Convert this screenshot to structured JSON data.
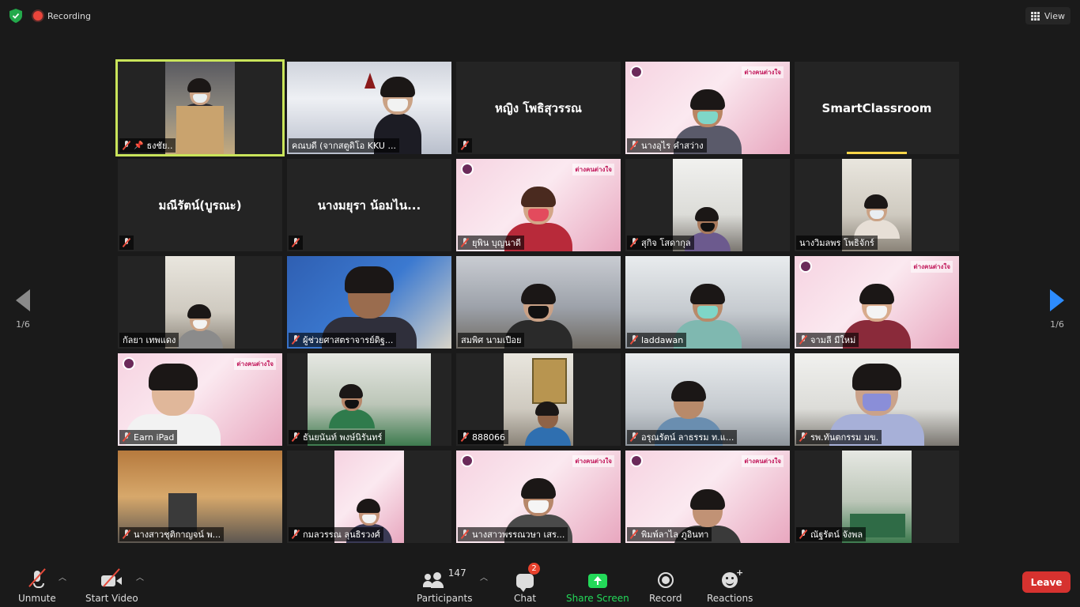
{
  "topbar": {
    "recording_label": "Recording",
    "view_label": "View"
  },
  "nav": {
    "prev_page": "1/6",
    "next_page": "1/6"
  },
  "participants": [
    {
      "name": "ธงชัย..",
      "type": "video",
      "active": true,
      "pinned": true
    },
    {
      "name": "คณบดี (จากสตูดิโอ KKU ...",
      "type": "video"
    },
    {
      "name": "หญิง โพธิสุวรรณ",
      "type": "name_only"
    },
    {
      "name": "นางอุไร คำสว่าง",
      "type": "video"
    },
    {
      "name": "SmartClassroom",
      "type": "name_only",
      "speaking": true
    },
    {
      "name": "มณีรัตน์(บูรณะ)",
      "type": "name_only"
    },
    {
      "name": "นางมยุรา น้อมไน...",
      "type": "name_only"
    },
    {
      "name": "ยุพิน บุญนาดี",
      "type": "video"
    },
    {
      "name": "สุกิจ โสดากุล",
      "type": "video"
    },
    {
      "name": "นางวิมลพร โพธิจักร์",
      "type": "video"
    },
    {
      "name": "กัลยา เทพแดง",
      "type": "video"
    },
    {
      "name": "ผู้ช่วยศาสตราจารย์ดิฐ...",
      "type": "video"
    },
    {
      "name": "สมพิศ นามเปือย",
      "type": "video"
    },
    {
      "name": "laddawan",
      "type": "video"
    },
    {
      "name": "จามลี มีใหม่",
      "type": "video"
    },
    {
      "name": "Earn iPad",
      "type": "video"
    },
    {
      "name": "ธันยนันท์ พงษ์นิรันทร์",
      "type": "video"
    },
    {
      "name": "888066",
      "type": "video"
    },
    {
      "name": "อรุณรัตน์ ลาธรรม ท.แ...",
      "type": "video"
    },
    {
      "name": "รพ.ทันตกรรม มข.",
      "type": "video"
    },
    {
      "name": "นางสาวชุติกาญจน์ พ...",
      "type": "video"
    },
    {
      "name": "กมลวรรณ ลุนธิรวงศ์",
      "type": "video"
    },
    {
      "name": "นางสาวพรรณวษา เสร...",
      "type": "video"
    },
    {
      "name": "พิมพ์ลาไล ภูอินทา",
      "type": "video"
    },
    {
      "name": "ณัฐรัตน์ จังพล",
      "type": "video"
    }
  ],
  "toolbar": {
    "unmute_label": "Unmute",
    "start_video_label": "Start Video",
    "participants_label": "Participants",
    "participants_count": "147",
    "chat_label": "Chat",
    "chat_badge": "2",
    "share_label": "Share Screen",
    "record_label": "Record",
    "reactions_label": "Reactions",
    "leave_label": "Leave"
  },
  "colors": {
    "accent_green": "#23d959",
    "leave_red": "#d6322f",
    "active_border": "#c9e45a",
    "nav_blue": "#2d8cff"
  }
}
